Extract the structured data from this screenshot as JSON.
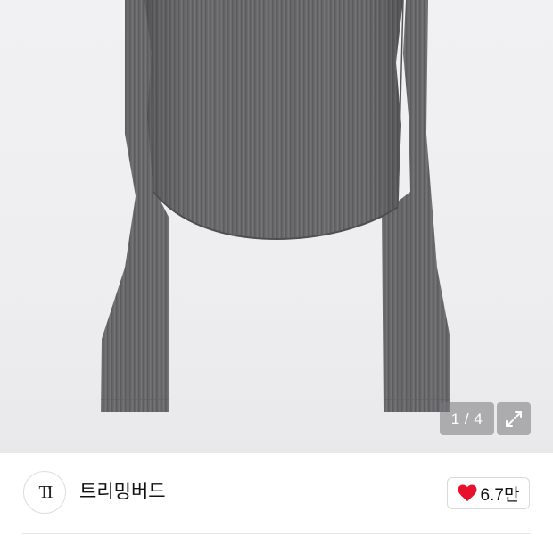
{
  "gallery": {
    "current_page": "1",
    "total_pages": "4",
    "page_indicator": "1 / 4",
    "image_icon": "product-photo",
    "fullscreen_icon": "expand-icon"
  },
  "store": {
    "logo_text": "TI",
    "name": "트리밍버드"
  },
  "like": {
    "icon": "heart-icon",
    "count": "6.7만",
    "heart_color": "#e8112d"
  },
  "colors": {
    "garment": "#6e6e70",
    "overlay": "rgba(120,120,125,0.55)"
  }
}
